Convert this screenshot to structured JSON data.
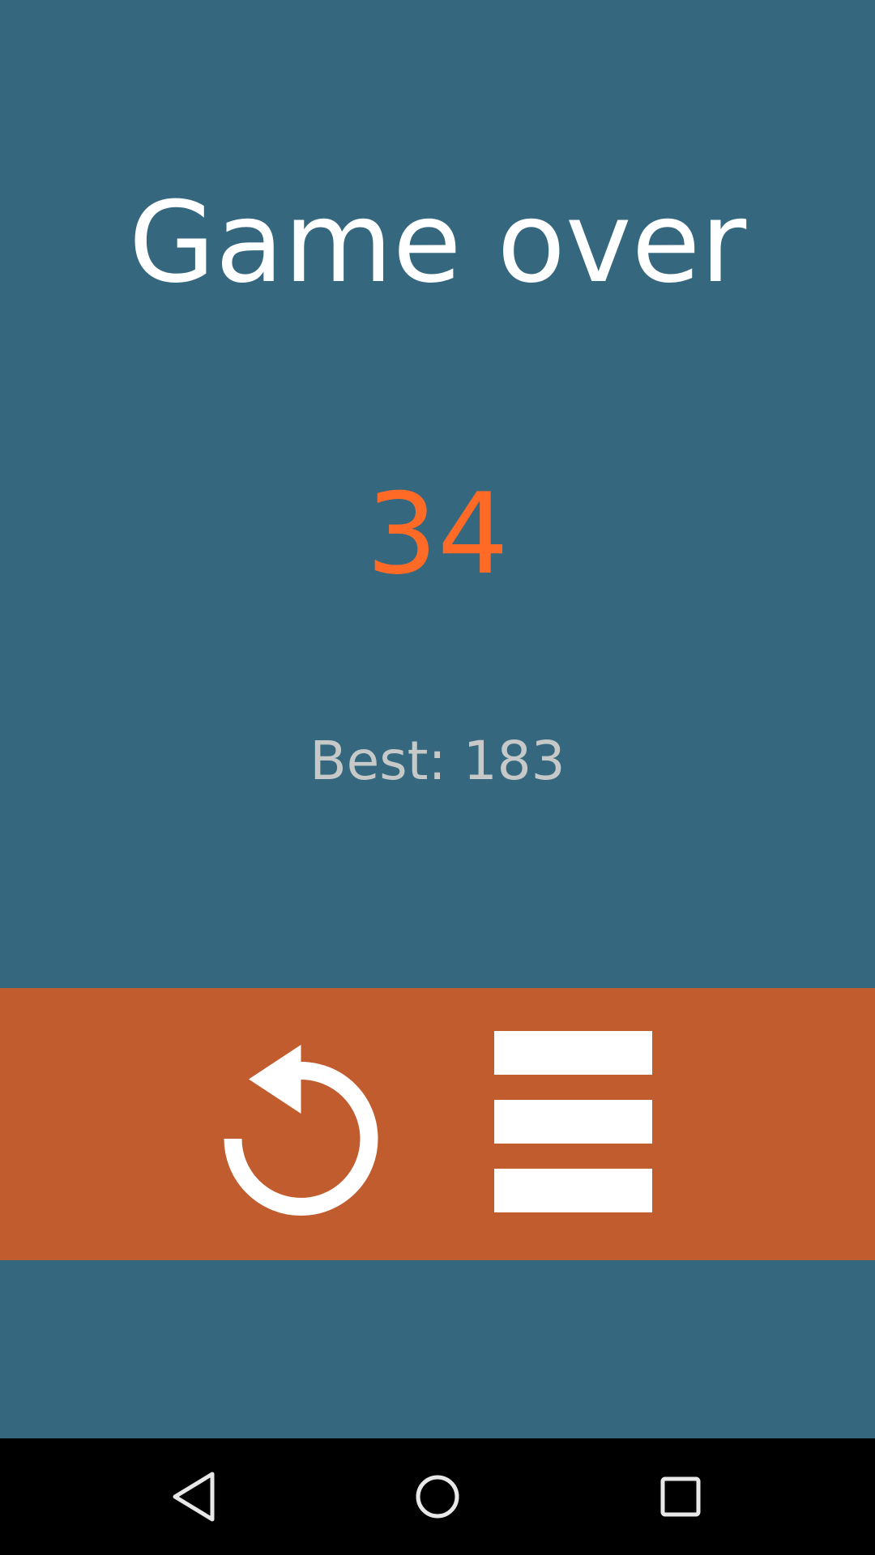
{
  "game": {
    "title": "Game over",
    "score": "34",
    "best_text": "Best: 183"
  },
  "actions": {
    "replay_icon": "replay-icon",
    "menu_icon": "hamburger-menu-icon"
  },
  "nav": {
    "back_icon": "back-triangle-icon",
    "home_icon": "home-circle-icon",
    "recents_icon": "recents-square-icon"
  },
  "colors": {
    "background": "#35687f",
    "action_bar": "#c15c2e",
    "score": "#ff6b27",
    "best_text": "#c7c9c9",
    "title": "#ffffff",
    "nav_bar": "#000000"
  }
}
